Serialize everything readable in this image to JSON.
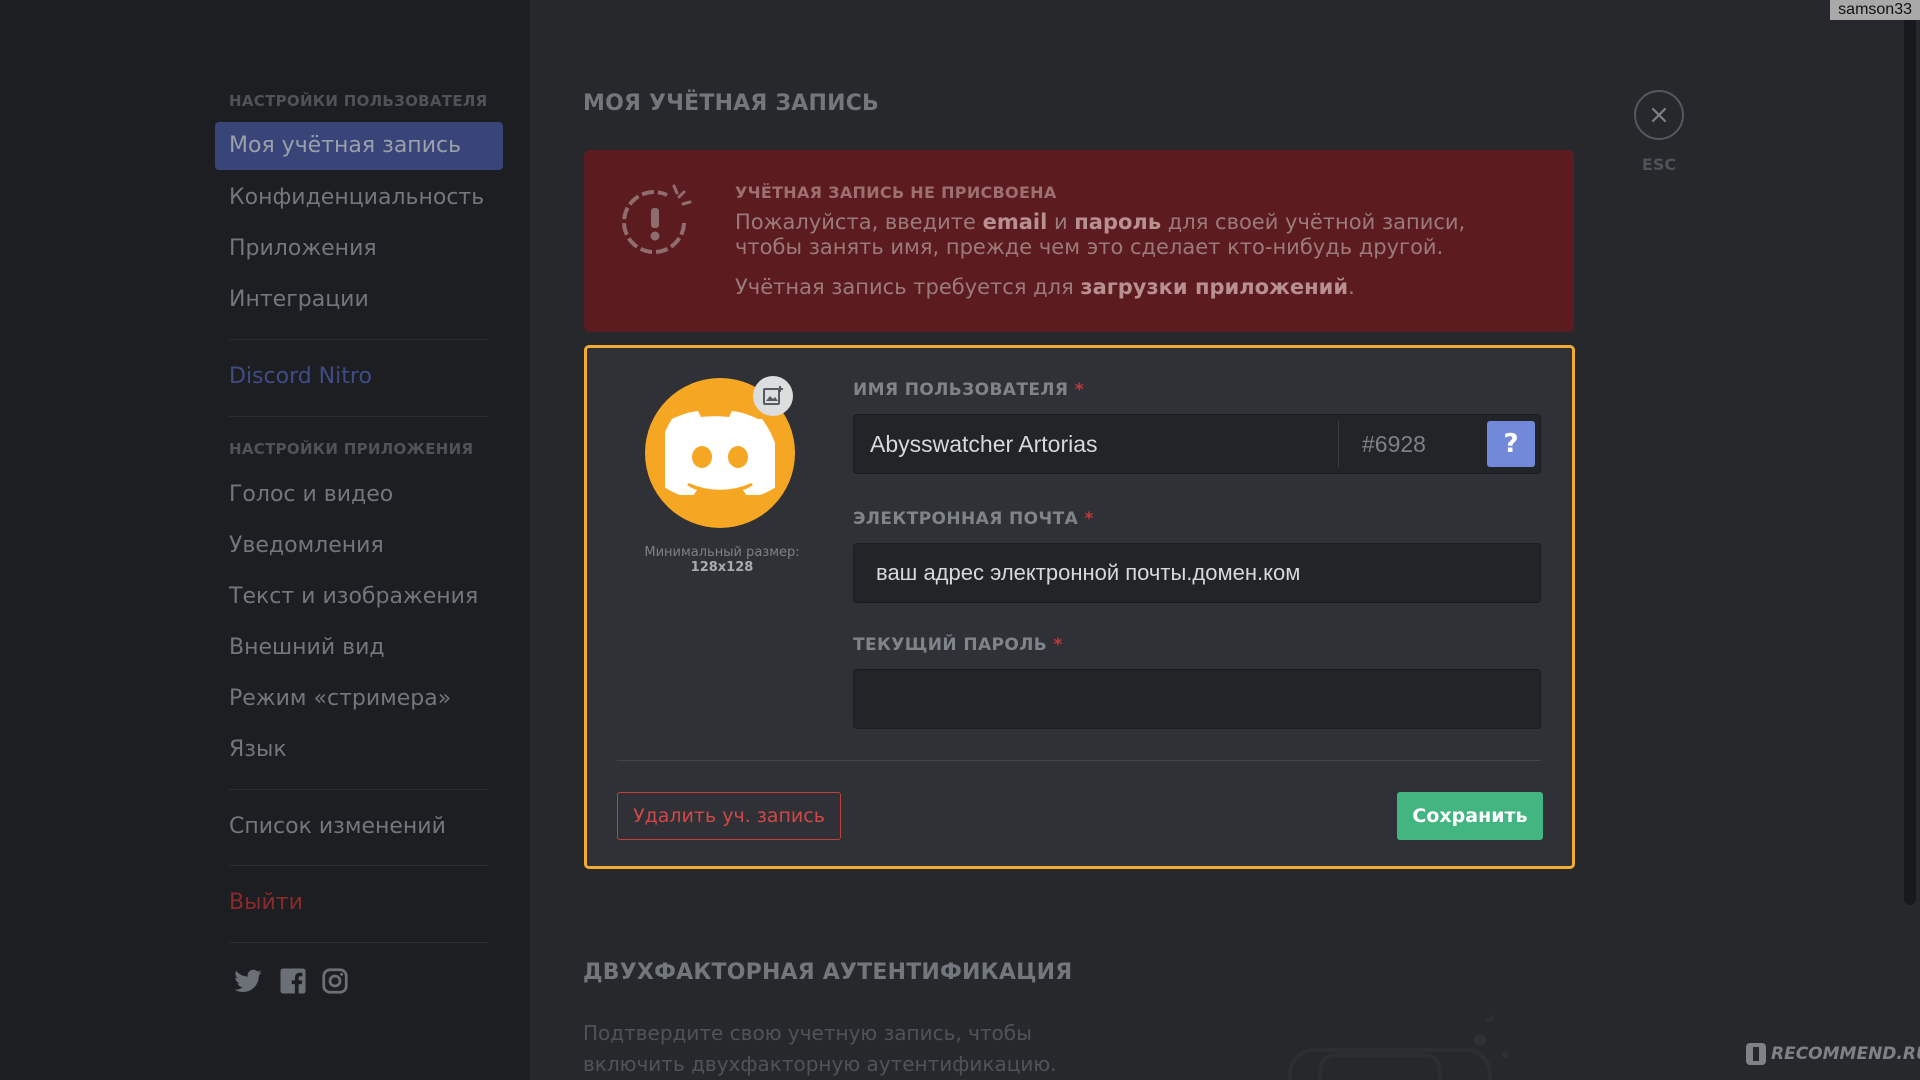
{
  "top_user_tag": "samson33",
  "sidebar": {
    "header_user": "НАСТРОЙКИ ПОЛЬЗОВАТЕЛЯ",
    "user_items": [
      {
        "label": "Моя учётная запись",
        "active": true
      },
      {
        "label": "Конфиденциальность"
      },
      {
        "label": "Приложения"
      },
      {
        "label": "Интеграции"
      }
    ],
    "nitro_label": "Discord Nitro",
    "header_app": "НАСТРОЙКИ ПРИЛОЖЕНИЯ",
    "app_items": [
      {
        "label": "Голос и видео"
      },
      {
        "label": "Уведомления"
      },
      {
        "label": "Текст и изображения"
      },
      {
        "label": "Внешний вид"
      },
      {
        "label": "Режим «стримера»"
      },
      {
        "label": "Язык"
      }
    ],
    "changelog_label": "Список изменений",
    "logout_label": "Выйти",
    "social": [
      "twitter-icon",
      "facebook-icon",
      "instagram-icon"
    ]
  },
  "main": {
    "title": "МОЯ УЧЁТНАЯ ЗАПИСЬ",
    "close_label": "ESC",
    "alert": {
      "title": "УЧЁТНАЯ ЗАПИСЬ НЕ ПРИСВОЕНА",
      "text_1": "Пожалуйста, введите ",
      "text_email": "email",
      "text_2": " и ",
      "text_password": "пароль",
      "text_3": " для своей учётной записи, чтобы занять имя, прежде чем это сделает кто-нибудь другой.",
      "text_4": "Учётная запись требуется для ",
      "text_bold": "загрузки приложений",
      "text_5": "."
    },
    "avatar_hint_text": "Минимальный размер: ",
    "avatar_hint_size": "128x128",
    "username": {
      "label": "ИМЯ ПОЛЬЗОВАТЕЛЯ",
      "required": "*",
      "value": "Abysswatcher Artorias",
      "discriminator": "#6928",
      "help": "?"
    },
    "email": {
      "label": "ЭЛЕКТРОННАЯ ПОЧТА",
      "required": "*",
      "value": "ваш адрес электронной почты.домен.ком"
    },
    "password": {
      "label": "ТЕКУЩИЙ ПАРОЛЬ",
      "required": "*",
      "value": ""
    },
    "delete_button": "Удалить уч. запись",
    "save_button": "Сохранить",
    "twofa": {
      "title": "ДВУХФАКТОРНАЯ АУТЕНТИФИКАЦИЯ",
      "text": "Подтвердите свою учетную запись, чтобы включить двухфакторную аутентификацию."
    }
  },
  "watermark": "RECOMMEND.RU",
  "colors": {
    "accent": "#7289da",
    "avatar": "#f5a623",
    "save": "#43b581",
    "danger": "#c03f3f",
    "focus_border": "#f1ad32"
  }
}
